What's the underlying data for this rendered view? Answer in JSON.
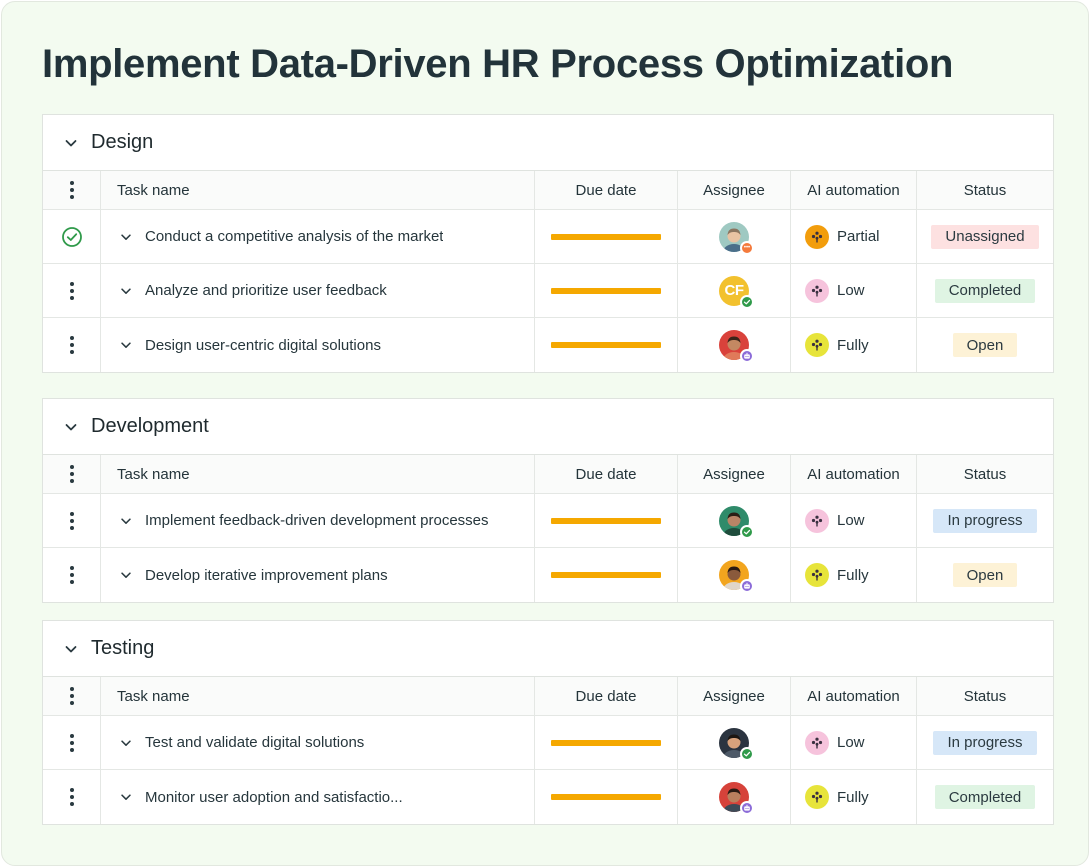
{
  "page": {
    "title": "Implement Data-Driven HR Process Optimization"
  },
  "columns": {
    "task_name": "Task name",
    "due_date": "Due date",
    "assignee": "Assignee",
    "ai_automation": "AI automation",
    "status": "Status"
  },
  "colors": {
    "due_bar": "#f5a800",
    "ai_partial": "#f29d0c",
    "ai_low": "#f6c3dc",
    "ai_fully": "#e7e43a",
    "status_unassigned": "#fde1e1",
    "status_completed": "#dff4e3",
    "status_open": "#fdf2d6",
    "status_in_progress": "#d6e7f8"
  },
  "groups": [
    {
      "title": "Design",
      "rows": [
        {
          "name": "Conduct a competitive analysis of the market",
          "menu": "check-circle-icon",
          "assignee_badge": "more",
          "assignee_kind": "photo-1",
          "ai": "Partial",
          "status": "Unassigned"
        },
        {
          "name": "Analyze and prioritize user feedback",
          "menu": "dots",
          "assignee_badge": "check",
          "assignee_kind": "initials",
          "assignee_initials": "CF",
          "ai": "Low",
          "status": "Completed"
        },
        {
          "name": "Design user-centric digital solutions",
          "menu": "dots",
          "assignee_badge": "bot",
          "assignee_kind": "photo-2",
          "ai": "Fully",
          "status": "Open"
        }
      ]
    },
    {
      "title": "Development",
      "rows": [
        {
          "name": "Implement feedback-driven development  processes",
          "menu": "dots",
          "assignee_badge": "check",
          "assignee_kind": "photo-3",
          "ai": "Low",
          "status": "In progress"
        },
        {
          "name": "Develop iterative improvement plans",
          "menu": "dots",
          "assignee_badge": "bot",
          "assignee_kind": "photo-4",
          "ai": "Fully",
          "status": "Open"
        }
      ]
    },
    {
      "title": "Testing",
      "rows": [
        {
          "name": "Test and validate digital solutions",
          "menu": "dots",
          "assignee_badge": "check",
          "assignee_kind": "photo-5",
          "ai": "Low",
          "status": "In progress"
        },
        {
          "name": "Monitor user adoption and satisfactio...",
          "menu": "dots",
          "assignee_badge": "bot",
          "assignee_kind": "photo-6",
          "ai": "Fully",
          "status": "Completed"
        }
      ]
    }
  ]
}
